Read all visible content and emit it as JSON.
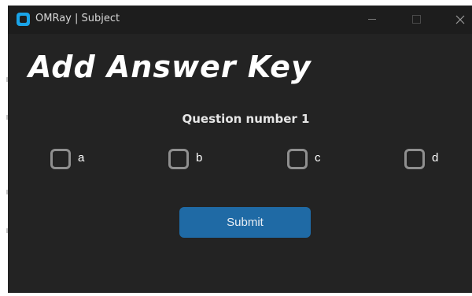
{
  "window": {
    "title": "OMRay | Subject"
  },
  "page": {
    "heading": "Add Answer Key",
    "question_label": "Question number 1"
  },
  "options": [
    {
      "label": "a",
      "checked": false
    },
    {
      "label": "b",
      "checked": false
    },
    {
      "label": "c",
      "checked": false
    },
    {
      "label": "d",
      "checked": false
    }
  ],
  "submit_label": "Submit",
  "colors": {
    "window_bg": "#232323",
    "titlebar_bg": "#1d1d1d",
    "accent": "#1f6aa5",
    "checkbox_border": "#8f8f8f",
    "app_icon": "#1aa4e8"
  },
  "icons": {
    "app": "omray-app-icon",
    "minimize": "minimize-icon",
    "maximize": "maximize-icon",
    "close": "close-icon"
  }
}
